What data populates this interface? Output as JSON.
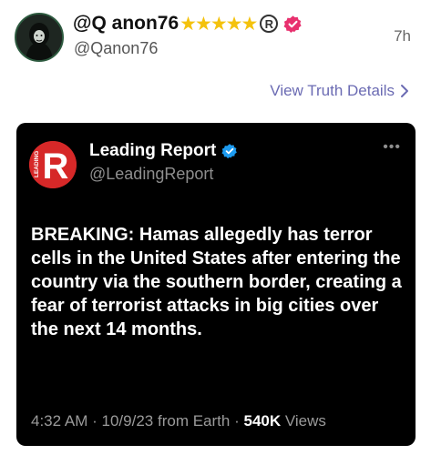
{
  "post": {
    "display_name": "@Q anon76",
    "handle": "@Qanon76",
    "timestamp": "7h",
    "star_count": 5,
    "registered_mark": "R",
    "avatar_icon": "hooded-figure-avatar"
  },
  "actions": {
    "view_details_label": "View Truth Details",
    "view_details_icon": "chevron-right-icon"
  },
  "embedded_post": {
    "display_name": "Leading Report",
    "handle": "@LeadingReport",
    "logo_letter": "R",
    "logo_side_text": "LEADING",
    "text": "BREAKING: Hamas allegedly has terror cells in the United States after entering the country via the southern border, creating a fear of terrorist attacks in big cities over the next 14 months.",
    "time": "4:32 AM",
    "date": "10/9/23",
    "source": "from Earth",
    "views_count": "540K",
    "views_label": "Views",
    "separator": "·"
  },
  "colors": {
    "link": "#6b6bb3",
    "star": "#f4c20d",
    "verified_pink": "#e8306e",
    "verified_blue": "#1d9bf0",
    "logo_red": "#d62828",
    "embed_bg": "#000000"
  }
}
